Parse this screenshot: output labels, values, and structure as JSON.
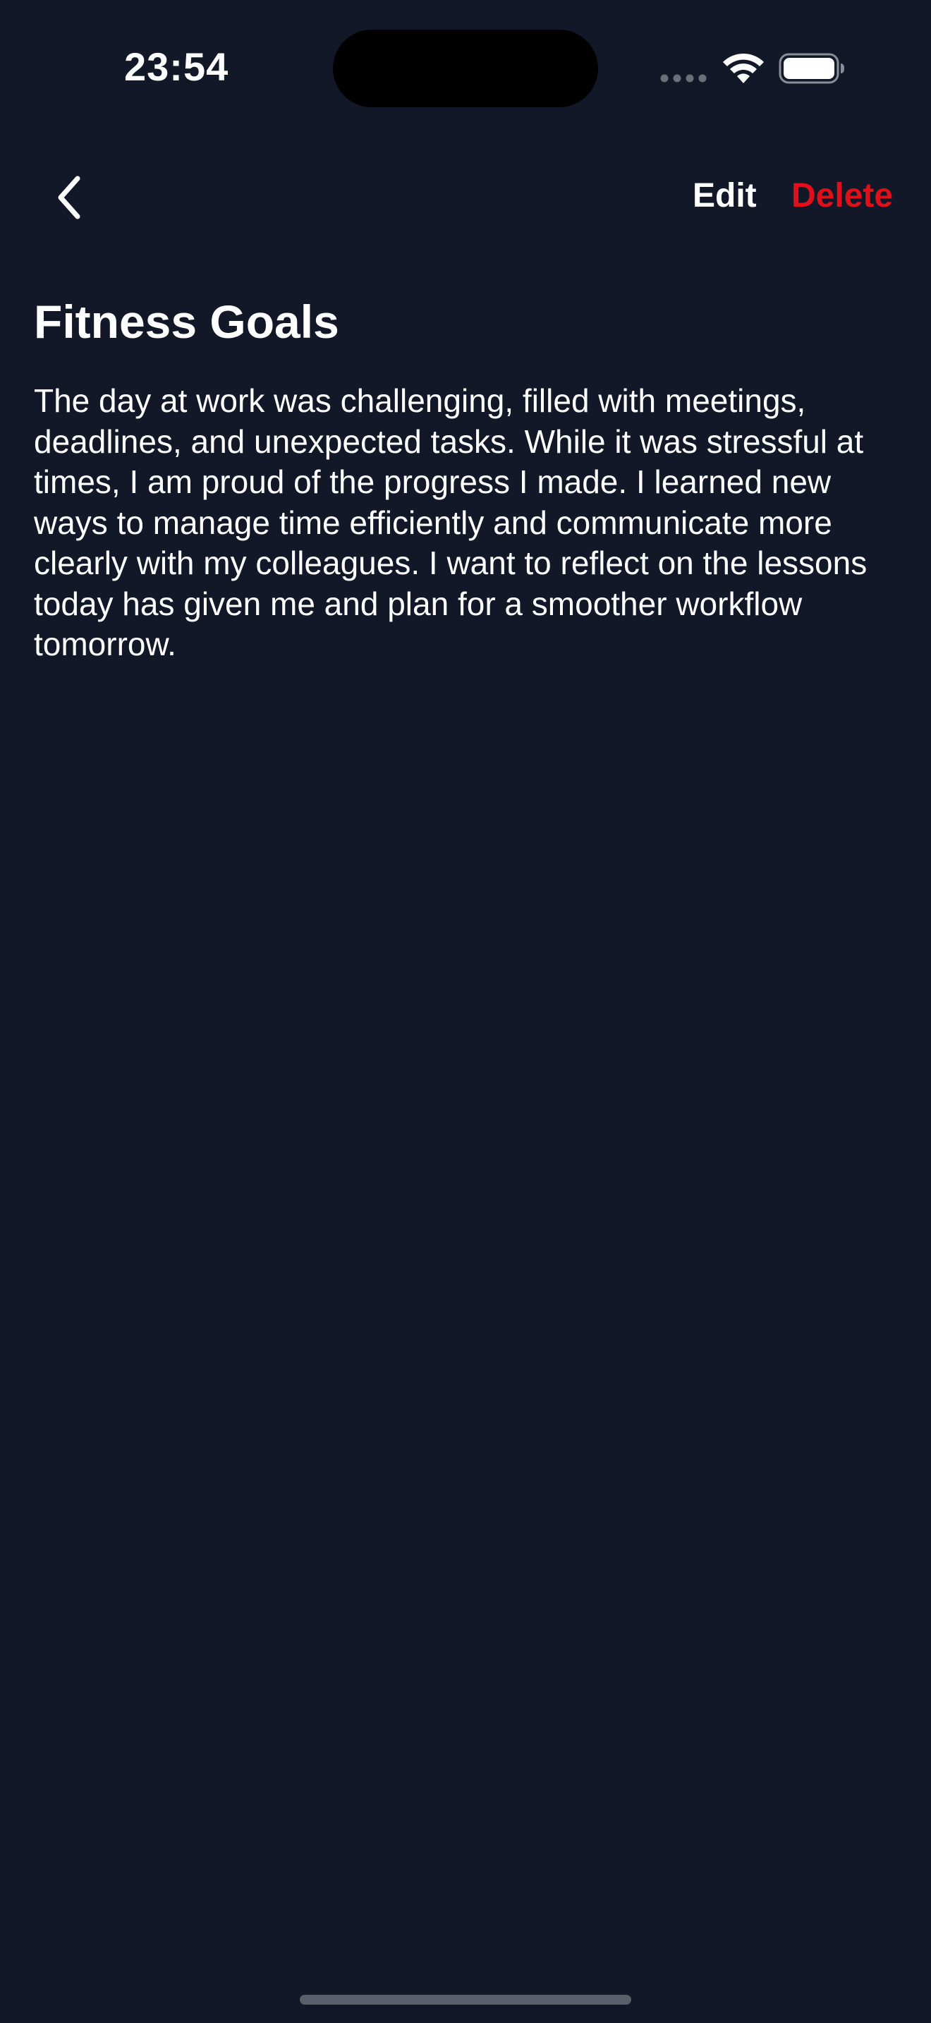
{
  "status_bar": {
    "time": "23:54",
    "icons": [
      "cellular-signal-icon",
      "wifi-icon",
      "battery-icon"
    ]
  },
  "nav": {
    "back_icon": "chevron-left-icon",
    "edit_label": "Edit",
    "delete_label": "Delete"
  },
  "entry": {
    "title": "Fitness Goals",
    "body": "The day at work was challenging, filled with meetings, deadlines, and unexpected tasks. While it was stressful at times, I am proud of the progress I made. I learned new ways to manage time efficiently and communicate more clearly with my colleagues. I want to reflect on the lessons today has given me and plan for a smoother workflow tomorrow."
  },
  "colors": {
    "background": "#121828",
    "text": "#ffffff",
    "delete": "#e0101a"
  }
}
